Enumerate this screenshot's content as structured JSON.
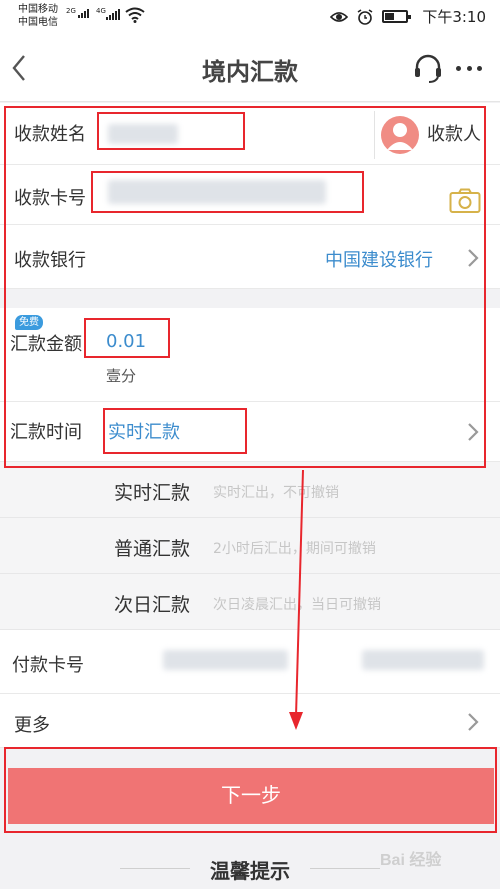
{
  "status_bar": {
    "carrier1": "中国移动",
    "carrier2": "中国电信",
    "net1": "2G",
    "net2": "4G",
    "time": "下午3:10"
  },
  "nav": {
    "title": "境内汇款"
  },
  "form": {
    "payee_name_label": "收款姓名",
    "payee_button_label": "收款人",
    "card_no_label": "收款卡号",
    "bank_label": "收款银行",
    "bank_value": "中国建设银行",
    "free_badge": "免费",
    "amount_label": "汇款金额",
    "amount_value": "0.01",
    "amount_words": "壹分",
    "time_label": "汇款时间",
    "time_value": "实时汇款"
  },
  "options": [
    {
      "name": "实时汇款",
      "desc": "实时汇出，不可撤销"
    },
    {
      "name": "普通汇款",
      "desc": "2小时后汇出，期间可撤销"
    },
    {
      "name": "次日汇款",
      "desc": "次日凌晨汇出，当日可撤销"
    }
  ],
  "payment": {
    "card_label": "付款卡号",
    "more_label": "更多"
  },
  "next_button": "下一步",
  "tips_title": "温馨提示",
  "watermark": "Bai 经验",
  "colors": {
    "accent_blue": "#3c8ccd",
    "button_red": "#f07474",
    "annotation_red": "#e8262d"
  }
}
